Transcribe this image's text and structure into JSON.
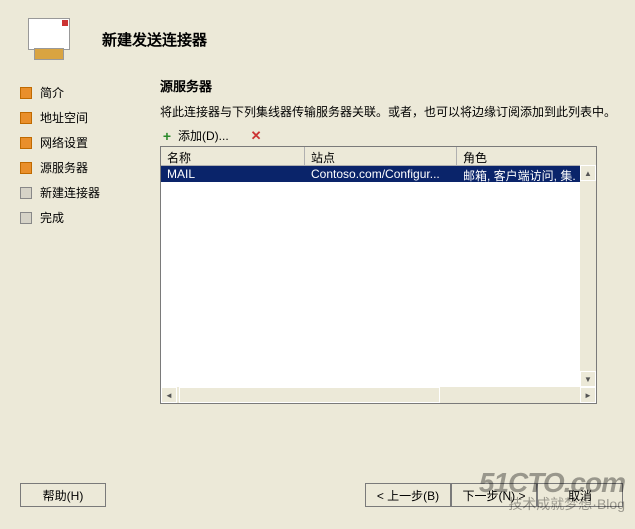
{
  "header": {
    "title": "新建发送连接器"
  },
  "sidebar": {
    "steps": [
      {
        "label": "简介",
        "state": "orange"
      },
      {
        "label": "地址空间",
        "state": "orange"
      },
      {
        "label": "网络设置",
        "state": "orange"
      },
      {
        "label": "源服务器",
        "state": "orange"
      },
      {
        "label": "新建连接器",
        "state": "grey"
      },
      {
        "label": "完成",
        "state": "grey"
      }
    ]
  },
  "panel": {
    "title": "源服务器",
    "description": "将此连接器与下列集线器传输服务器关联。或者，也可以将边缘订阅添加到此列表中。"
  },
  "toolbar": {
    "add_label": "添加(D)..."
  },
  "table": {
    "headers": {
      "name": "名称",
      "site": "站点",
      "role": "角色"
    },
    "rows": [
      {
        "name": "MAIL",
        "site": "Contoso.com/Configur...",
        "role": "邮箱, 客户端访问, 集."
      }
    ]
  },
  "buttons": {
    "help": "帮助(H)",
    "back": "< 上一步(B)",
    "next": "下一步(N) >",
    "cancel": "取消"
  },
  "watermark": {
    "line1": "51CTO.com",
    "line2": "技术成就梦想·Blog"
  }
}
